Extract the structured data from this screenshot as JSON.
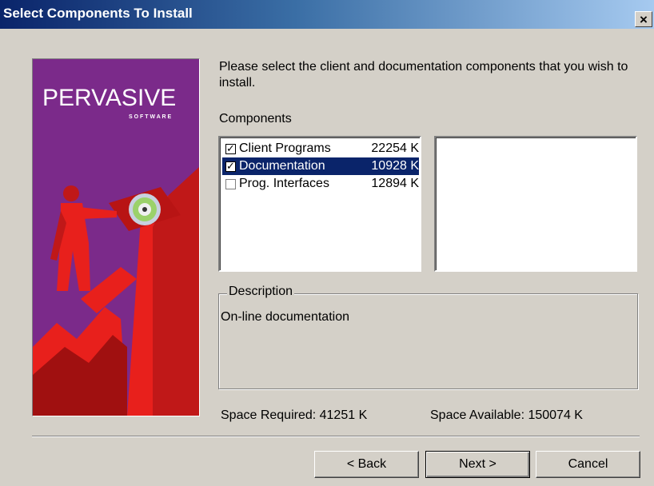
{
  "window": {
    "title": "Select Components To Install",
    "close_glyph": "×"
  },
  "banner": {
    "logo_text": "PERVASIVE",
    "logo_subtext": "S O F T W A R E"
  },
  "prompt": "Please select the client and documentation components that you wish to install.",
  "components": {
    "label": "Components",
    "items": [
      {
        "name": "Client Programs",
        "size": "22254 K",
        "checked": true,
        "selected": false
      },
      {
        "name": "Documentation",
        "size": "10928 K",
        "checked": true,
        "selected": true
      },
      {
        "name": "Prog. Interfaces",
        "size": "12894 K",
        "checked": false,
        "selected": false
      }
    ]
  },
  "description": {
    "label": "Description",
    "text": "On-line documentation"
  },
  "space": {
    "required": "Space Required:  41251 K",
    "available": "Space Available:  150074 K"
  },
  "buttons": {
    "back": "< Back",
    "next": "Next >",
    "cancel": "Cancel"
  },
  "colors": {
    "title_gradient_start": "#0a246a",
    "title_gradient_end": "#a6caf0",
    "dialog_bg": "#d4d0c8",
    "selection": "#0a246a",
    "banner_purple": "#7b2a8a",
    "banner_red": "#e8201c"
  }
}
